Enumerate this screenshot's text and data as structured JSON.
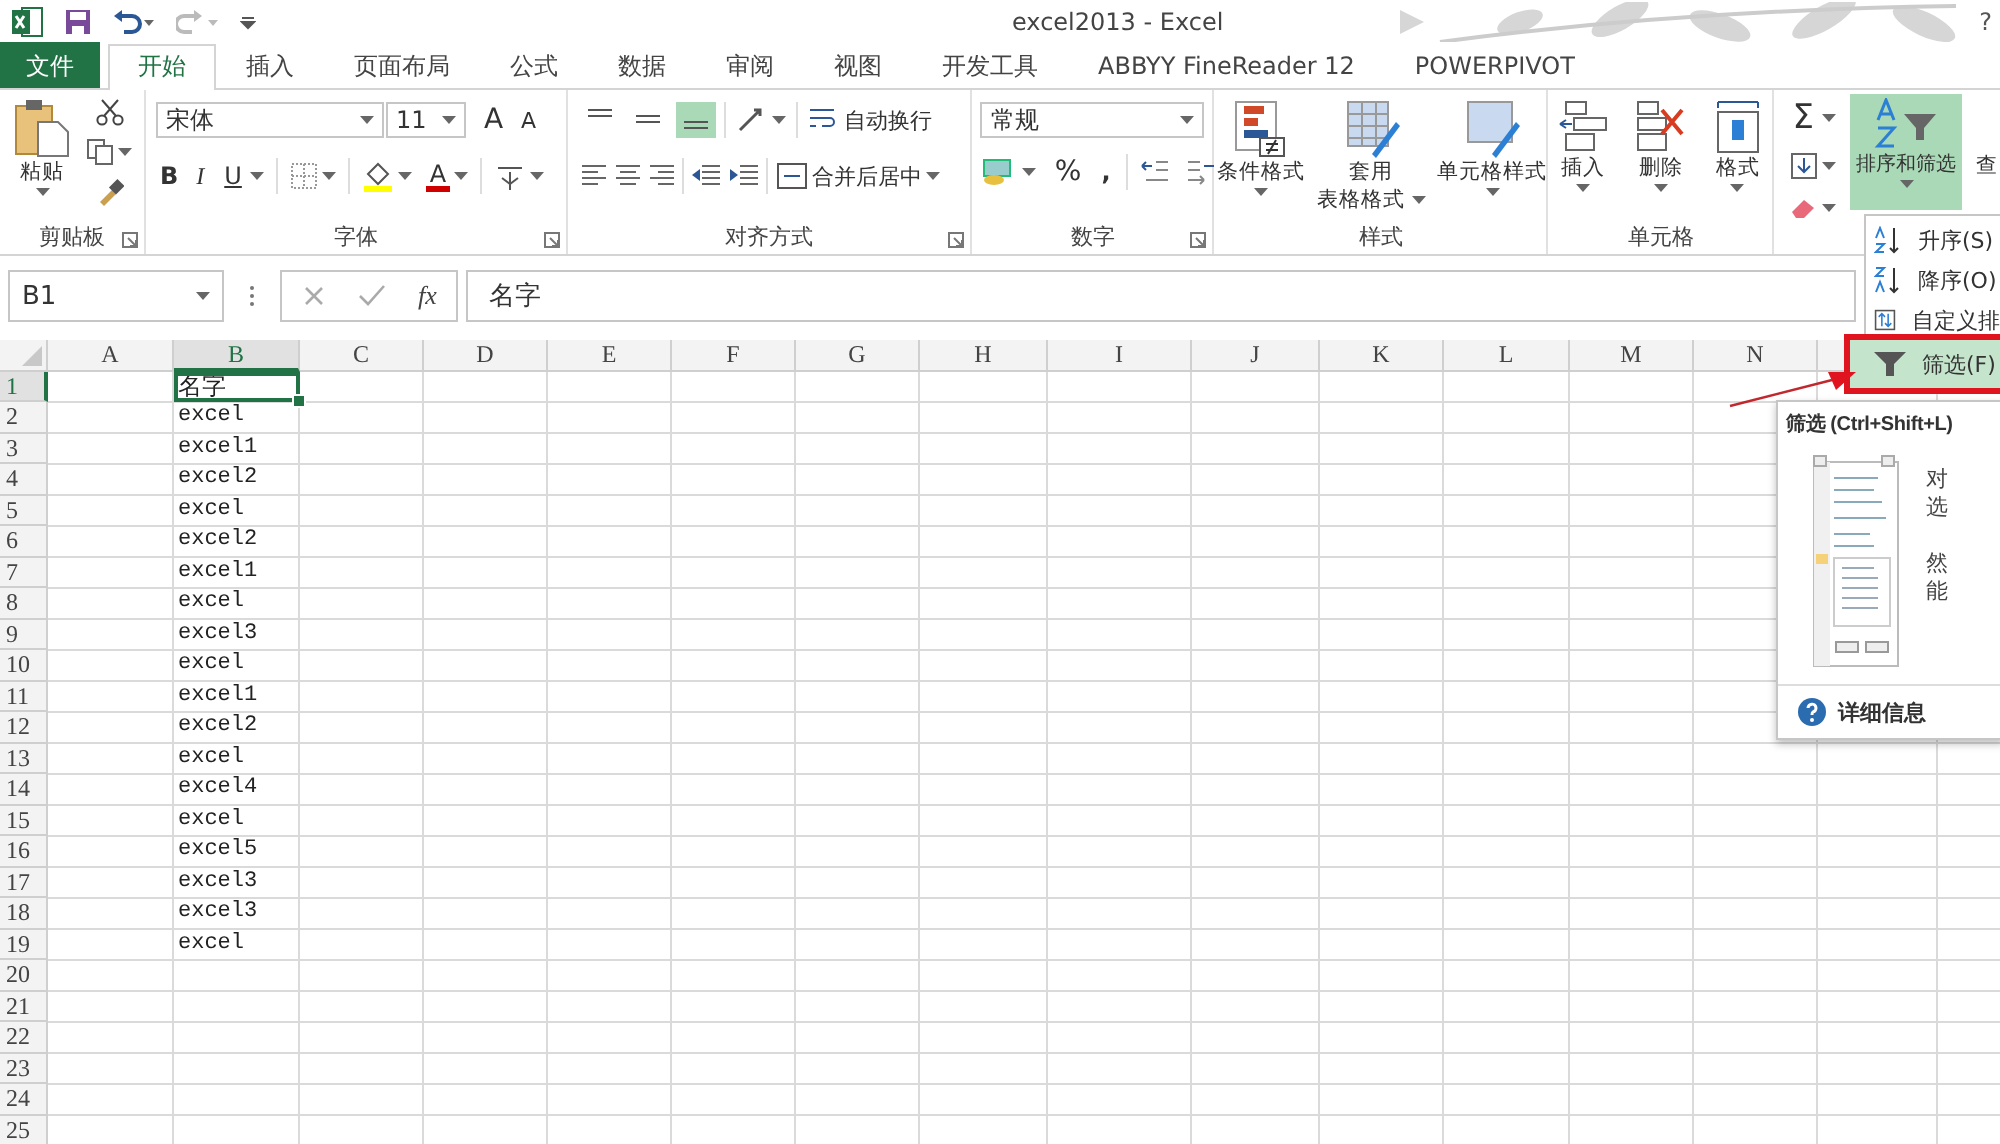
{
  "window": {
    "title": "excel2013 - Excel",
    "help": "?"
  },
  "tabs": [
    {
      "label": "文件",
      "kind": "file",
      "selected": false
    },
    {
      "label": "开始",
      "kind": "tab",
      "selected": true
    },
    {
      "label": "插入",
      "kind": "tab",
      "selected": false
    },
    {
      "label": "页面布局",
      "kind": "tab",
      "selected": false
    },
    {
      "label": "公式",
      "kind": "tab",
      "selected": false
    },
    {
      "label": "数据",
      "kind": "tab",
      "selected": false
    },
    {
      "label": "审阅",
      "kind": "tab",
      "selected": false
    },
    {
      "label": "视图",
      "kind": "tab",
      "selected": false
    },
    {
      "label": "开发工具",
      "kind": "tab",
      "selected": false
    },
    {
      "label": "ABBYY FineReader 12",
      "kind": "tab",
      "selected": false
    },
    {
      "label": "POWERPIVOT",
      "kind": "tab",
      "selected": false
    }
  ],
  "ribbon": {
    "clipboard": {
      "label": "剪贴板",
      "paste": "粘贴"
    },
    "font": {
      "label": "字体",
      "font_name": "宋体",
      "font_size": "11",
      "grow": "A",
      "shrink": "A",
      "bold": "B",
      "italic": "I",
      "underline": "U",
      "font_color": "A"
    },
    "alignment": {
      "label": "对齐方式",
      "vertical_align": [
        {
          "selected": false
        },
        {
          "selected": false
        },
        {
          "selected": true
        }
      ],
      "wrap_text": "自动换行",
      "merge_center": "合并后居中"
    },
    "number": {
      "label": "数字",
      "format": "常规",
      "percent": "%",
      "comma": ","
    },
    "styles": {
      "label": "样式",
      "buttons": [
        {
          "lines": [
            "条件格式"
          ]
        },
        {
          "lines": [
            "套用",
            "表格格式"
          ]
        },
        {
          "lines": [
            "单元格样式"
          ]
        }
      ]
    },
    "cells": {
      "label": "单元格",
      "buttons": [
        {
          "label": "插入",
          "kind": "insert"
        },
        {
          "label": "删除",
          "kind": "delete"
        },
        {
          "label": "格式",
          "kind": "format"
        }
      ]
    },
    "editing": {
      "sum": "Σ",
      "sort_filter": {
        "label": "排序和筛选",
        "pressed": true
      },
      "find": "查"
    }
  },
  "formula_bar": {
    "name_box": "B1",
    "fx": "fx",
    "formula": "名字"
  },
  "sheet": {
    "columns": [
      {
        "label": "A",
        "selected": false
      },
      {
        "label": "B",
        "selected": true
      },
      {
        "label": "C",
        "selected": false
      },
      {
        "label": "D",
        "selected": false
      },
      {
        "label": "E",
        "selected": false
      },
      {
        "label": "F",
        "selected": false
      },
      {
        "label": "G",
        "selected": false
      },
      {
        "label": "H",
        "selected": false
      },
      {
        "label": "I",
        "selected": false
      },
      {
        "label": "J",
        "selected": false
      },
      {
        "label": "K",
        "selected": false
      },
      {
        "label": "L",
        "selected": false
      },
      {
        "label": "M",
        "selected": false
      },
      {
        "label": "N",
        "selected": false
      }
    ],
    "rows": [
      {
        "header": "1",
        "selected": true,
        "column_b": "名字"
      },
      {
        "header": "2",
        "selected": false,
        "column_b": "excel"
      },
      {
        "header": "3",
        "selected": false,
        "column_b": "excel1"
      },
      {
        "header": "4",
        "selected": false,
        "column_b": "excel2"
      },
      {
        "header": "5",
        "selected": false,
        "column_b": "excel"
      },
      {
        "header": "6",
        "selected": false,
        "column_b": "excel2"
      },
      {
        "header": "7",
        "selected": false,
        "column_b": "excel1"
      },
      {
        "header": "8",
        "selected": false,
        "column_b": "excel"
      },
      {
        "header": "9",
        "selected": false,
        "column_b": "excel3"
      },
      {
        "header": "10",
        "selected": false,
        "column_b": "excel"
      },
      {
        "header": "11",
        "selected": false,
        "column_b": "excel1"
      },
      {
        "header": "12",
        "selected": false,
        "column_b": "excel2"
      },
      {
        "header": "13",
        "selected": false,
        "column_b": "excel"
      },
      {
        "header": "14",
        "selected": false,
        "column_b": "excel4"
      },
      {
        "header": "15",
        "selected": false,
        "column_b": "excel"
      },
      {
        "header": "16",
        "selected": false,
        "column_b": "excel5"
      },
      {
        "header": "17",
        "selected": false,
        "column_b": "excel3"
      },
      {
        "header": "18",
        "selected": false,
        "column_b": "excel3"
      },
      {
        "header": "19",
        "selected": false,
        "column_b": "excel"
      },
      {
        "header": "20",
        "selected": false
      },
      {
        "header": "21",
        "selected": false
      },
      {
        "header": "22",
        "selected": false
      },
      {
        "header": "23",
        "selected": false
      },
      {
        "header": "24",
        "selected": false
      },
      {
        "header": "25",
        "selected": false
      }
    ]
  },
  "sort_menu": {
    "items": [
      {
        "label": "升序(S)",
        "kind": "asc",
        "selected": false
      },
      {
        "label": "降序(O)",
        "kind": "desc",
        "selected": false
      },
      {
        "label": "自定义排",
        "kind": "custom",
        "selected": false
      },
      {
        "label": "筛选(F)",
        "kind": "filter",
        "selected": true
      }
    ]
  },
  "tooltip": {
    "title": "筛选 (Ctrl+Shift+L)",
    "lines": [
      "对",
      "选",
      "然",
      "能"
    ],
    "link": "详细信息"
  }
}
